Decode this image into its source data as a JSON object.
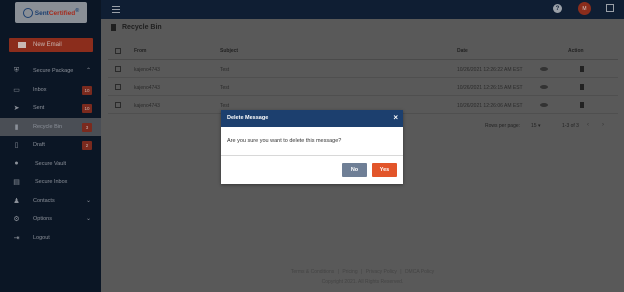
{
  "colors": {
    "sidebar_bg": "#0b1625",
    "topbar_bg": "#0f1e33",
    "modal_header": "#1c3f6e",
    "accent": "#e2552a",
    "no_button": "#6f7f96"
  },
  "brand": {
    "logo_text_a": "Sent",
    "logo_text_b": "Certified",
    "logo_mark": "®"
  },
  "sidebar": {
    "new_email": "New Email",
    "items": [
      {
        "label": "Secure Package",
        "icon": "shield-icon"
      },
      {
        "label": "Inbox",
        "icon": "inbox-icon",
        "badge": "10"
      },
      {
        "label": "Sent",
        "icon": "send-icon",
        "badge": "10"
      },
      {
        "label": "Recycle Bin",
        "icon": "trash-icon",
        "badge": "3"
      },
      {
        "label": "Draft",
        "icon": "draft-icon",
        "badge": "2"
      },
      {
        "label": "Secure Vault",
        "icon": "vault-icon"
      },
      {
        "label": "Secure Inbox",
        "icon": "secure-inbox-icon"
      },
      {
        "label": "Contacts",
        "icon": "person-icon"
      },
      {
        "label": "Options",
        "icon": "gear-icon"
      },
      {
        "label": "Logout",
        "icon": "logout-icon"
      }
    ]
  },
  "topbar": {
    "help": "?",
    "avatar": "M"
  },
  "page": {
    "title": "Recycle Bin"
  },
  "table": {
    "headers": {
      "from": "From",
      "subject": "Subject",
      "date": "Date",
      "action": "Action"
    },
    "rows": [
      {
        "from": "kajeno4743",
        "subject": "Test",
        "date": "10/26/2021 12:26:22 AM EST"
      },
      {
        "from": "kajeno4743",
        "subject": "Test",
        "date": "10/26/2021 12:26:15 AM EST"
      },
      {
        "from": "kajeno4743",
        "subject": "Test",
        "date": "10/26/2021 12:26:06 AM EST"
      }
    ]
  },
  "pager": {
    "rows_per_page_label": "Rows per page:",
    "rows_per_page": "15",
    "range": "1-3 of 3"
  },
  "footer": {
    "links": [
      "Terms & Conditions",
      "Pricing",
      "Privacy Policy",
      "DMCA Policy"
    ],
    "separator": "|",
    "copyright": "Copyright 2021. All Rights Reserved."
  },
  "modal": {
    "title": "Delete Message",
    "close": "×",
    "message": "Are you sure you want to delete this message?",
    "no_label": "No",
    "yes_label": "Yes"
  }
}
